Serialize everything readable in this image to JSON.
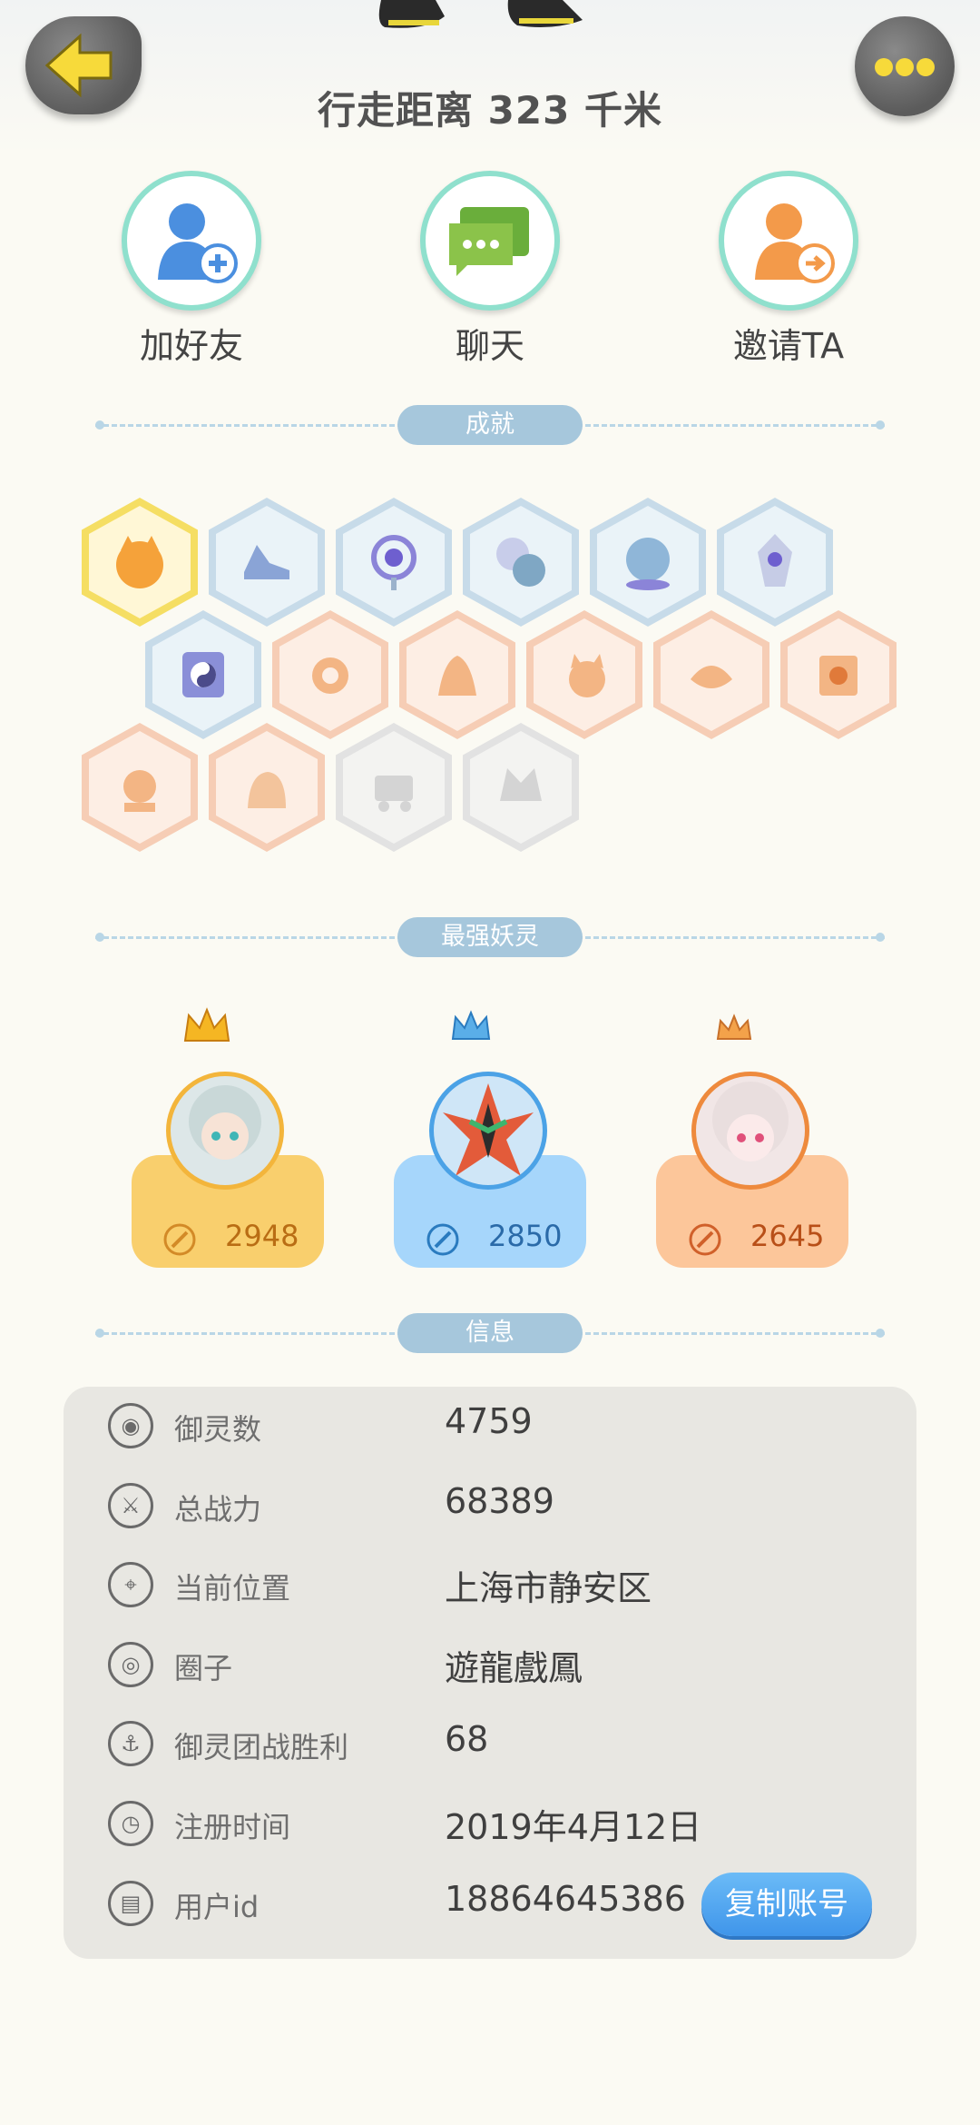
{
  "header": {
    "title": "行走距离 323 千米"
  },
  "actions": [
    {
      "label": "加好友",
      "icon": "add-friend-icon"
    },
    {
      "label": "聊天",
      "icon": "chat-icon"
    },
    {
      "label": "邀请TA",
      "icon": "invite-icon"
    }
  ],
  "sections": {
    "achievements": "成就",
    "strongest": "最强妖灵",
    "info": "信息"
  },
  "spirits": [
    {
      "score": "2948",
      "color": "#f9cf6d",
      "icon": "crown-gold-icon"
    },
    {
      "score": "2850",
      "color": "#a6d6fb",
      "icon": "crown-blue-icon"
    },
    {
      "score": "2645",
      "color": "#fcc69a",
      "icon": "crown-orange-icon"
    }
  ],
  "info": {
    "rows": [
      {
        "label": "御灵数",
        "value": "4759",
        "icon": "spirit-count-icon"
      },
      {
        "label": "总战力",
        "value": "68389",
        "icon": "sword-icon"
      },
      {
        "label": "当前位置",
        "value": "上海市静安区",
        "icon": "location-icon"
      },
      {
        "label": "圈子",
        "value": "遊龍戲鳳",
        "icon": "circle-icon"
      },
      {
        "label": "御灵团战胜利",
        "value": "68",
        "icon": "team-battle-icon"
      },
      {
        "label": "注册时间",
        "value": "2019年4月12日",
        "icon": "clock-icon"
      },
      {
        "label": "用户id",
        "value": "18864645386",
        "icon": "id-icon"
      }
    ],
    "copy_button": "复制账号"
  }
}
